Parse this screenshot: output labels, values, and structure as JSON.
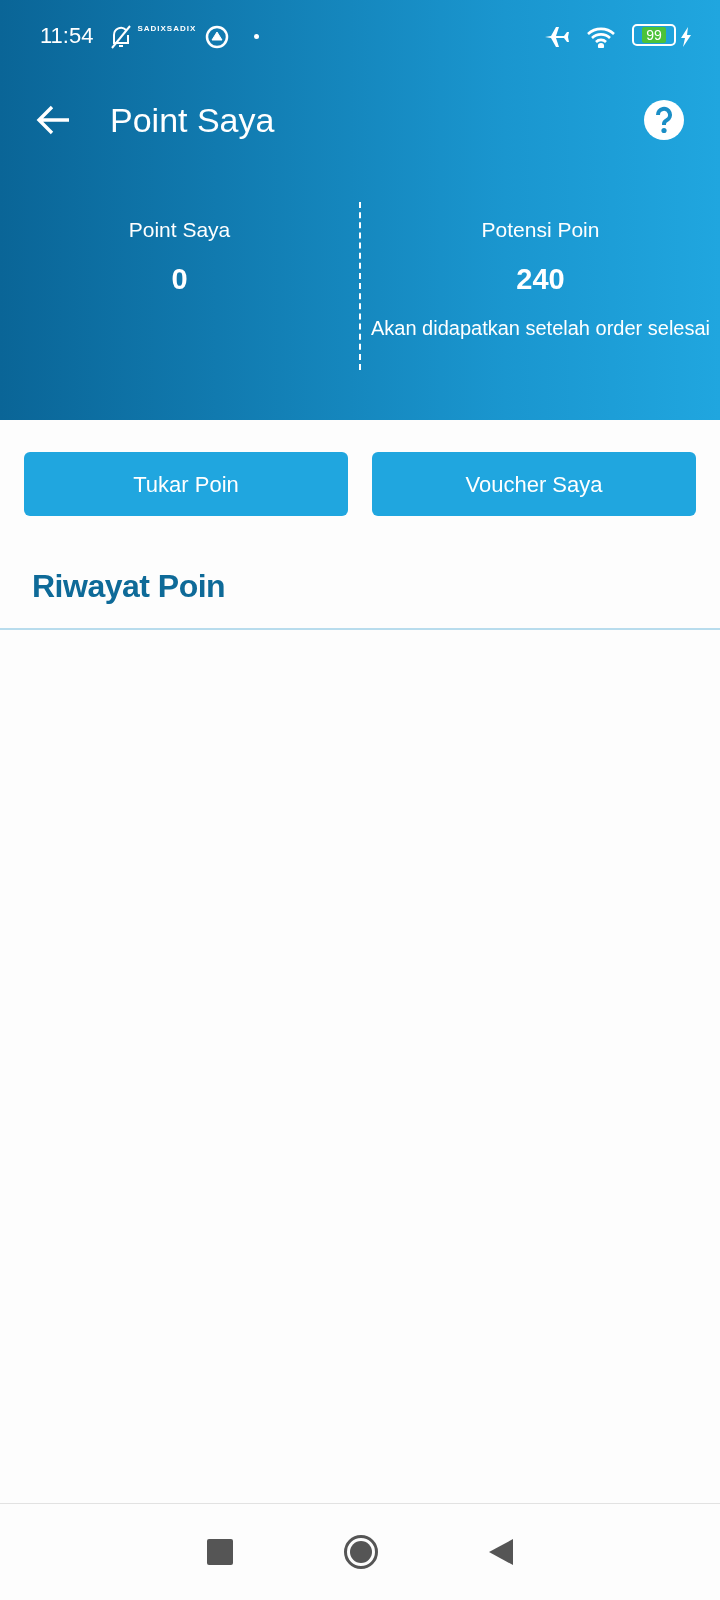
{
  "status_bar": {
    "time": "11:54",
    "notification_text": "SADIXSADIX",
    "battery": "99"
  },
  "app_bar": {
    "title": "Point Saya"
  },
  "summary": [
    {
      "label": "Point Saya",
      "value": "0"
    },
    {
      "label": "Potensi Poin",
      "value": "240",
      "note": "Akan didapatkan setelah order selesai"
    }
  ],
  "buttons": [
    "Tukar Poin",
    "Voucher Saya"
  ],
  "history": {
    "title": "Riwayat Poin"
  }
}
